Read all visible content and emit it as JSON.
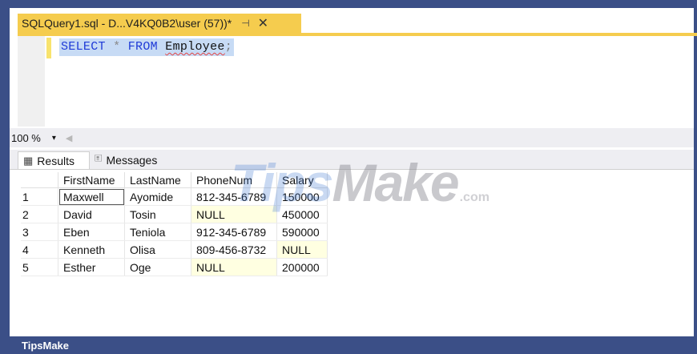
{
  "colors": {
    "frame": "#3b4f87",
    "active_tab": "#f5cc4e",
    "null_cell": "#ffffe1",
    "keyword": "#1f3bd7",
    "selection": "#c7dbf5"
  },
  "document_tab": {
    "title": "SQLQuery1.sql - D...V4KQ0B2\\user (57))*",
    "pin_icon": "pin-icon",
    "pin_glyph": "⊣",
    "close_glyph": "✕"
  },
  "editor": {
    "keyword_select": "SELECT",
    "operator_star": "*",
    "keyword_from": "FROM",
    "table_name": "Employee",
    "terminator": ";"
  },
  "zoom": {
    "value": "100 %",
    "dropdown_glyph": "▾",
    "scroll_glyph": "◀"
  },
  "result_tabs": {
    "results_label": "Results",
    "results_icon_glyph": "▦",
    "messages_label": "Messages",
    "messages_icon_glyph": "🗉"
  },
  "grid": {
    "columns": [
      "FirstName",
      "LastName",
      "PhoneNum",
      "Salary"
    ],
    "rows": [
      {
        "num": "1",
        "FirstName": "Maxwell",
        "LastName": "Ayomide",
        "PhoneNum": "812-345-6789",
        "Salary": "150000"
      },
      {
        "num": "2",
        "FirstName": "David",
        "LastName": "Tosin",
        "PhoneNum": "NULL",
        "Salary": "450000"
      },
      {
        "num": "3",
        "FirstName": "Eben",
        "LastName": "Teniola",
        "PhoneNum": "912-345-6789",
        "Salary": "590000"
      },
      {
        "num": "4",
        "FirstName": "Kenneth",
        "LastName": "Olisa",
        "PhoneNum": "809-456-8732",
        "Salary": "NULL"
      },
      {
        "num": "5",
        "FirstName": "Esther",
        "LastName": "Oge",
        "PhoneNum": "NULL",
        "Salary": "200000"
      }
    ]
  },
  "watermark": {
    "part1": "Tips",
    "part2": "Make",
    "suffix": ".com"
  },
  "footer": {
    "brand": "TipsMake"
  }
}
